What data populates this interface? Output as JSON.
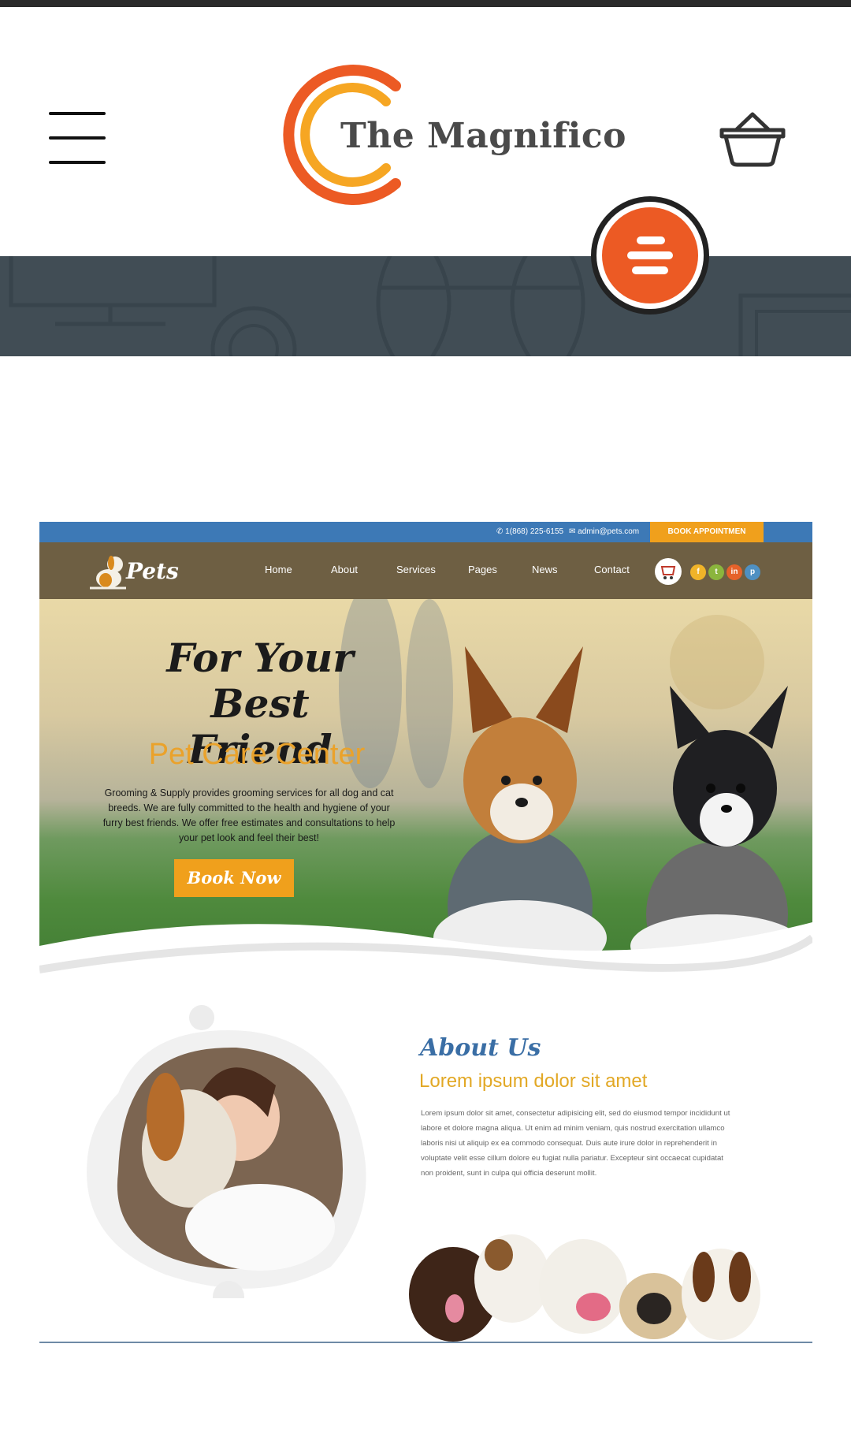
{
  "header": {
    "menu_icon": "hamburger-menu-icon",
    "logo_text": "The Magnifico",
    "cart_icon": "basket-icon",
    "fab_icon": "menu-lines-icon"
  },
  "colors": {
    "brand_orange": "#ec5a24",
    "brand_yellow": "#f6a623",
    "banner": "#414d55",
    "mock_blue": "#3d79b6",
    "mock_accent": "#f0a01c"
  },
  "mockup": {
    "topbar": {
      "phone": "1(868) 225-6155",
      "email": "admin@pets.com",
      "book_button": "BOOK APPOINTMEN"
    },
    "logo_text": "Pets",
    "nav": [
      "Home",
      "About",
      "Services",
      "Pages",
      "News",
      "Contact"
    ],
    "social": [
      "f",
      "t",
      "in",
      "p"
    ],
    "hero": {
      "title_line1": "For Your",
      "title_line2": "Best Friend",
      "subtitle": "Pet Care Center",
      "description": "Grooming & Supply provides grooming services for all dog and cat breeds. We are fully committed to the health and hygiene of your furry best friends. We offer free estimates and consultations to help your pet look and feel their best!",
      "button": "Book Now"
    },
    "about": {
      "title": "About Us",
      "subtitle": "Lorem ipsum dolor sit amet",
      "text": "Lorem ipsum dolor sit amet, consectetur adipisicing elit, sed do eiusmod tempor incididunt ut labore et dolore magna aliqua. Ut enim ad minim veniam, quis nostrud exercitation ullamco laboris nisi ut aliquip ex ea commodo consequat. Duis aute irure dolor in reprehenderit in voluptate velit esse cillum dolore eu fugiat nulla pariatur. Excepteur sint occaecat cupidatat non proident, sunt in culpa qui officia deserunt mollit."
    }
  }
}
